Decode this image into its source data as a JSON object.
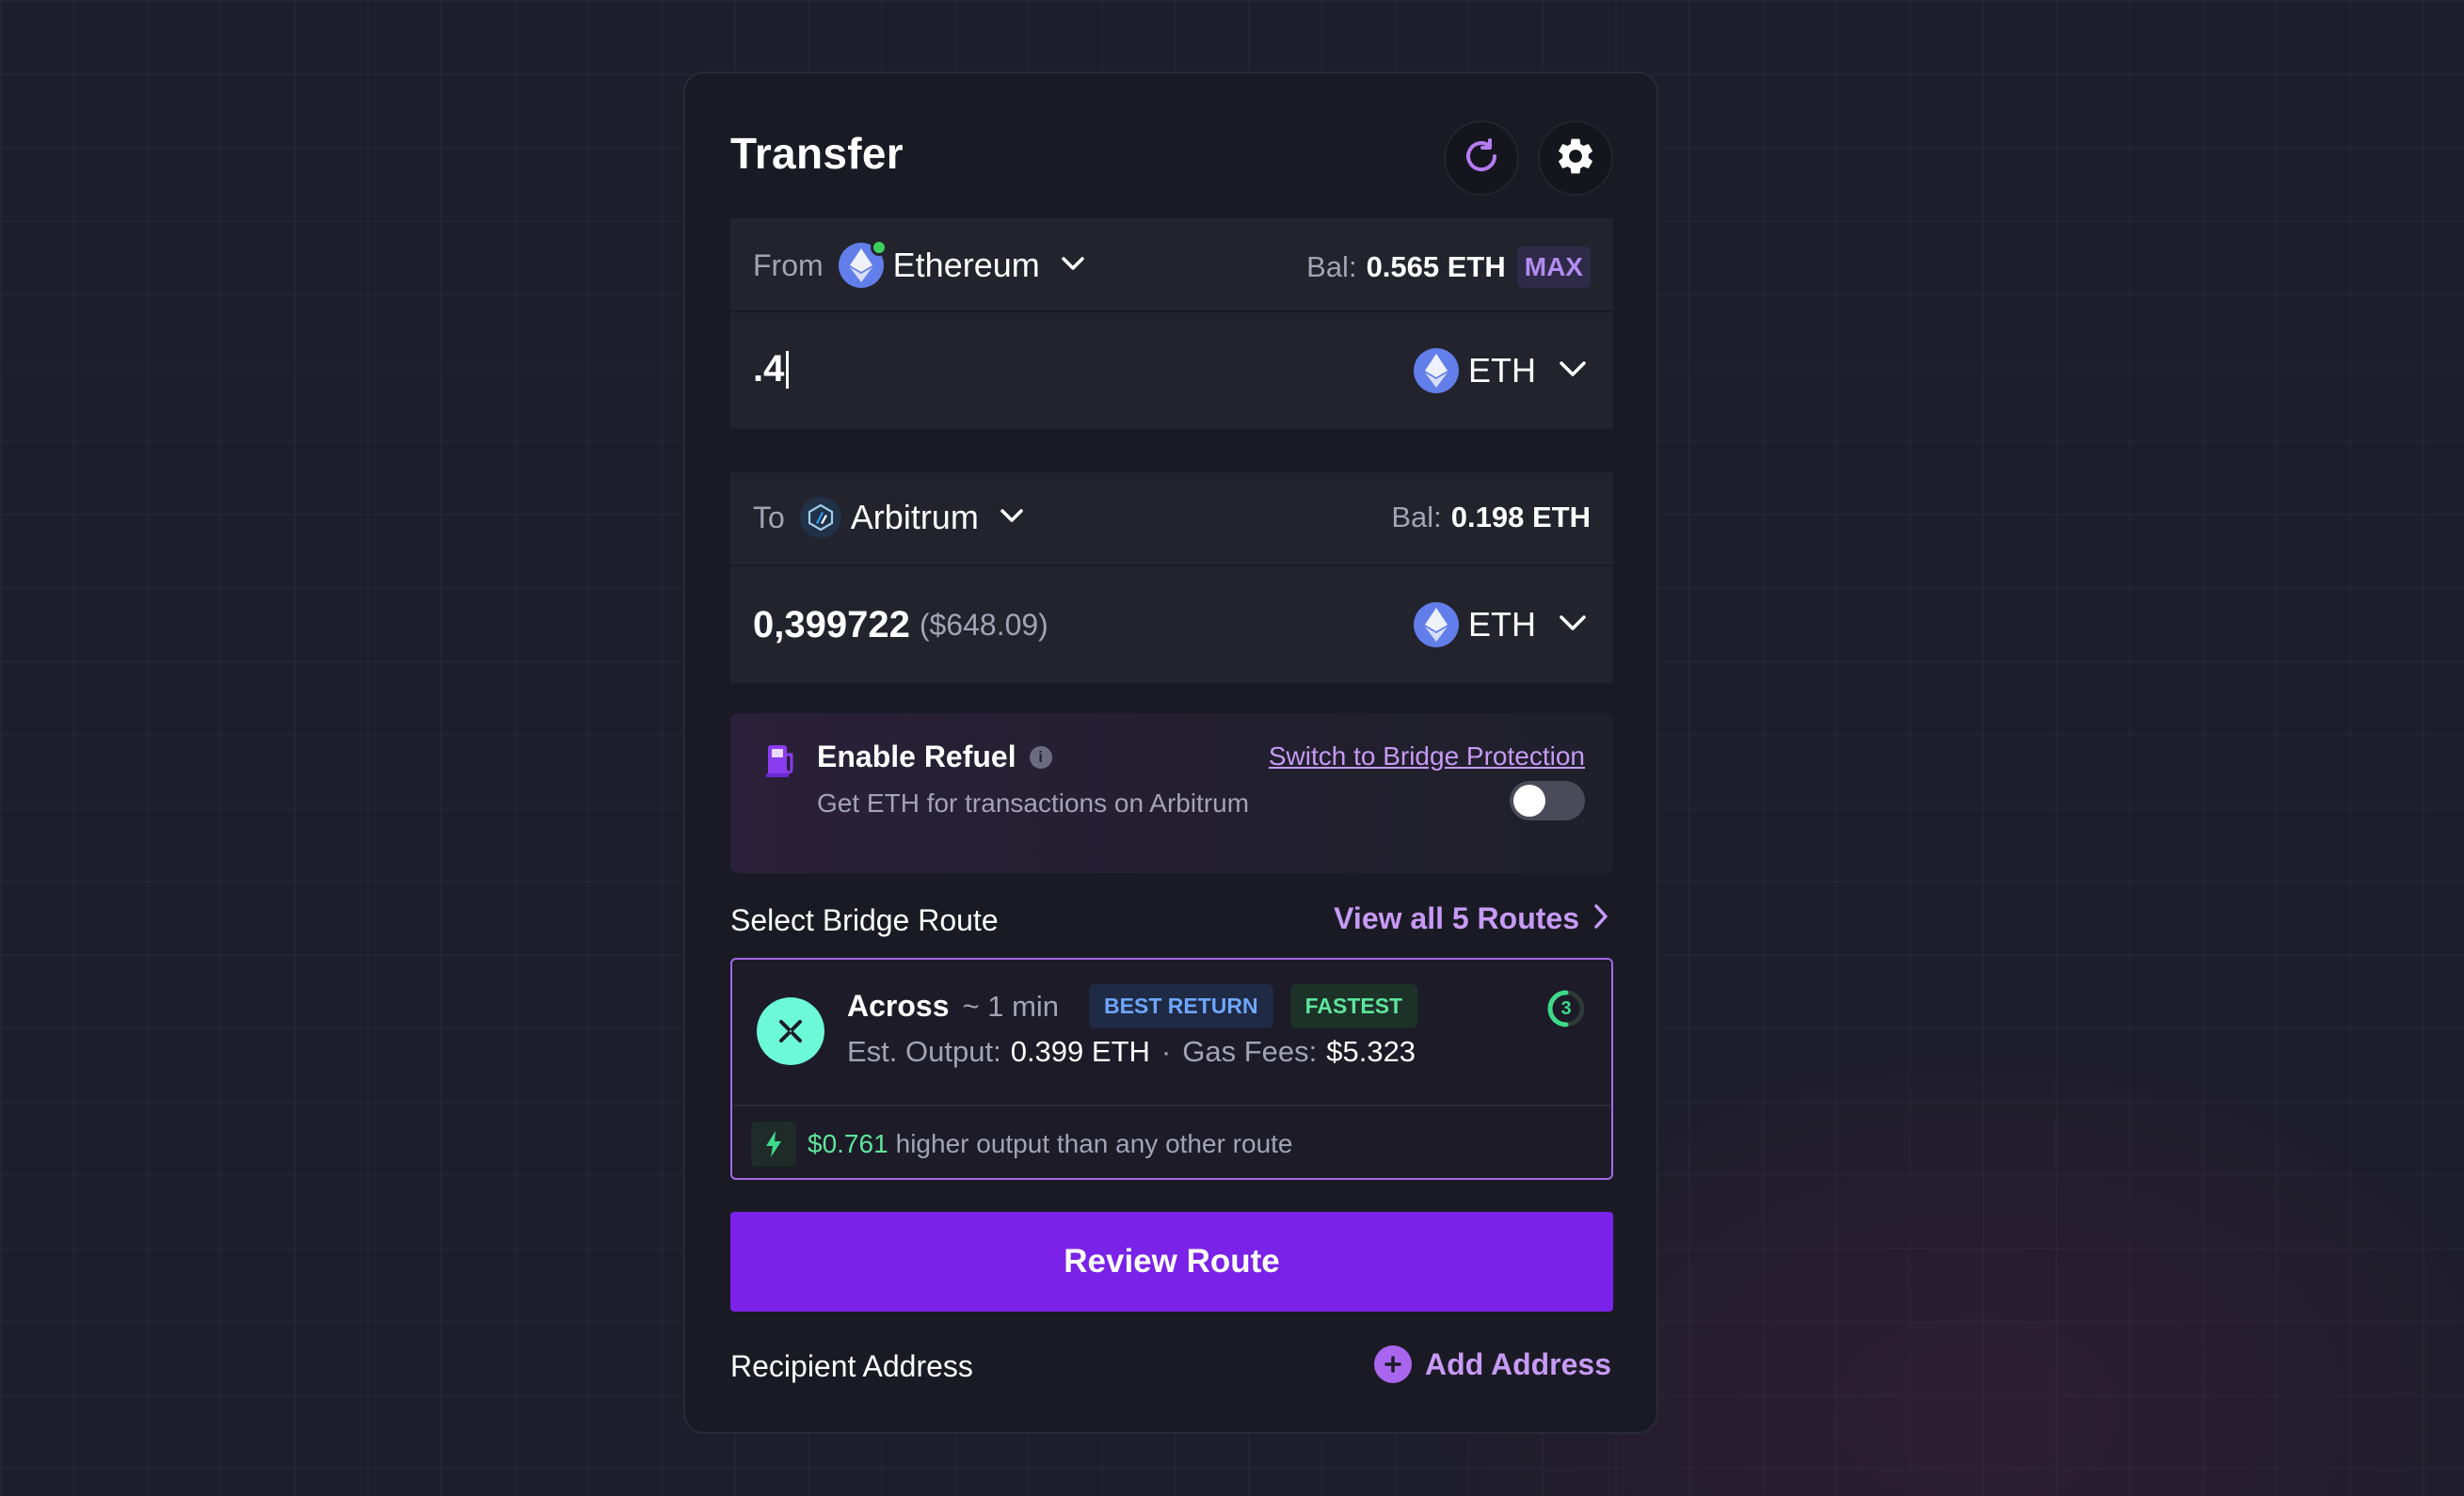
{
  "header": {
    "title": "Transfer",
    "refresh_icon": "refresh-icon",
    "settings_icon": "gear-icon"
  },
  "from": {
    "label": "From",
    "network": "Ethereum",
    "balance_label": "Bal:",
    "balance_value": "0.565 ETH",
    "max_label": "MAX",
    "amount": ".4",
    "token": "ETH"
  },
  "to": {
    "label": "To",
    "network": "Arbitrum",
    "balance_label": "Bal:",
    "balance_value": "0.198 ETH",
    "amount": "0,399722",
    "amount_usd": "($648.09)",
    "token": "ETH"
  },
  "refuel": {
    "title": "Enable Refuel",
    "subtitle": "Get ETH for transactions on Arbitrum",
    "link": "Switch to Bridge Protection",
    "enabled": false
  },
  "routes": {
    "section_title": "Select Bridge Route",
    "view_all": "View all 5 Routes",
    "selected": {
      "name": "Across",
      "time": "~ 1 min",
      "badges": [
        "BEST RETURN",
        "FASTEST"
      ],
      "output_label": "Est. Output:",
      "output_value": "0.399 ETH",
      "separator": "·",
      "gas_label": "Gas Fees:",
      "gas_value": "$5.323",
      "timer": "3",
      "savings_amount": "$0.761",
      "savings_text": "higher output than any other route"
    }
  },
  "review_button": "Review Route",
  "recipient": {
    "label": "Recipient Address",
    "add_label": "Add Address"
  },
  "colors": {
    "accent": "#7a22e8",
    "link": "#c79af5",
    "green": "#4ade80",
    "across": "#6cf9d8"
  }
}
